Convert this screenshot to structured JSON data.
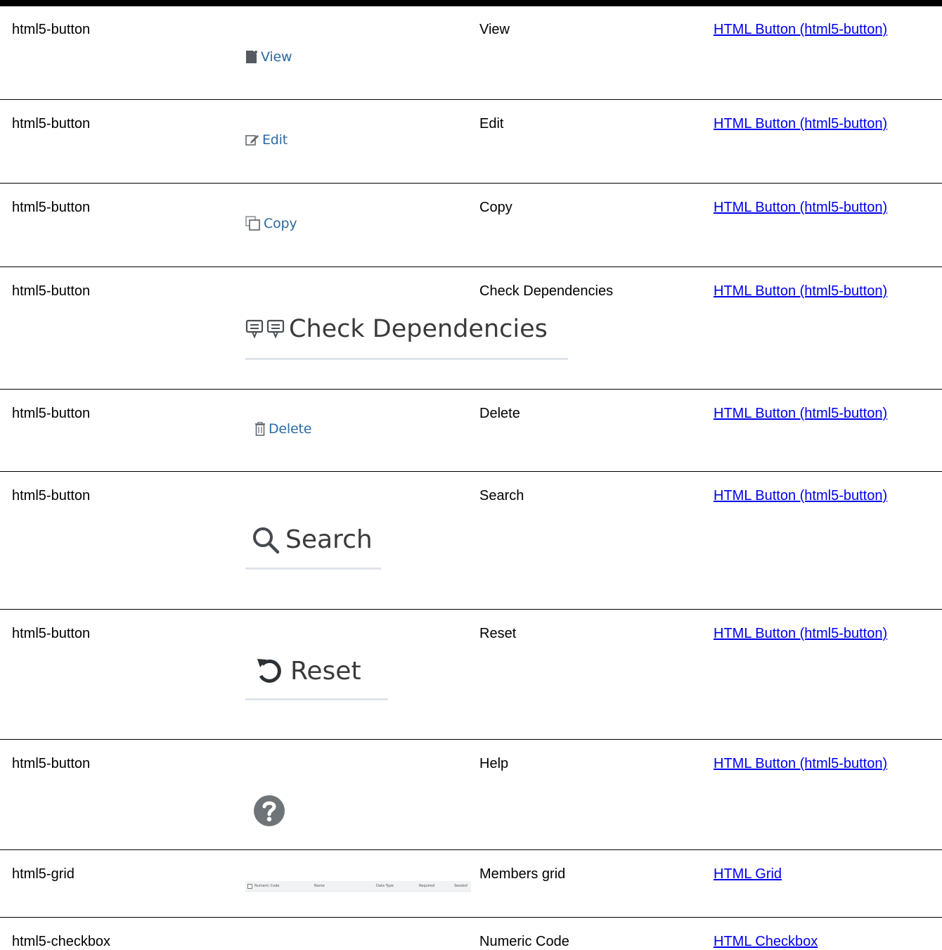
{
  "rows": [
    {
      "type": "html5-button",
      "label": "View",
      "link": "HTML Button (html5-button)",
      "shot_label": "View",
      "icon": "view-icon"
    },
    {
      "type": "html5-button",
      "label": "Edit",
      "link": "HTML Button (html5-button)",
      "shot_label": "Edit",
      "icon": "edit-icon"
    },
    {
      "type": "html5-button",
      "label": "Copy",
      "link": "HTML Button (html5-button)",
      "shot_label": "Copy",
      "icon": "copy-icon"
    },
    {
      "type": "html5-button",
      "label": "Check Dependencies",
      "link": "HTML Button (html5-button)",
      "shot_label": "Check Dependencies",
      "icon": "dependencies-icon"
    },
    {
      "type": "html5-button",
      "label": "Delete",
      "link": "HTML Button (html5-button)",
      "shot_label": "Delete",
      "icon": "trash-icon"
    },
    {
      "type": "html5-button",
      "label": "Search",
      "link": "HTML Button (html5-button)",
      "shot_label": "Search",
      "icon": "search-icon"
    },
    {
      "type": "html5-button",
      "label": "Reset",
      "link": "HTML Button (html5-button)",
      "shot_label": "Reset",
      "icon": "reset-icon"
    },
    {
      "type": "html5-button",
      "label": "Help",
      "link": "HTML Button (html5-button)",
      "shot_label": "",
      "icon": "help-icon"
    },
    {
      "type": "html5-grid",
      "label": "Members grid",
      "link": "HTML Grid",
      "grid_columns": [
        "Numeric Code",
        "Name",
        "Data Type",
        "Required",
        "Seeded"
      ]
    },
    {
      "type": "html5-checkbox",
      "label": "Numeric Code",
      "link": "HTML Checkbox"
    }
  ],
  "colors": {
    "link": "#0000ee",
    "icon_blue": "#2b6aa3",
    "icon_gray": "#3a3a3a",
    "help_circle": "#6f7478"
  }
}
